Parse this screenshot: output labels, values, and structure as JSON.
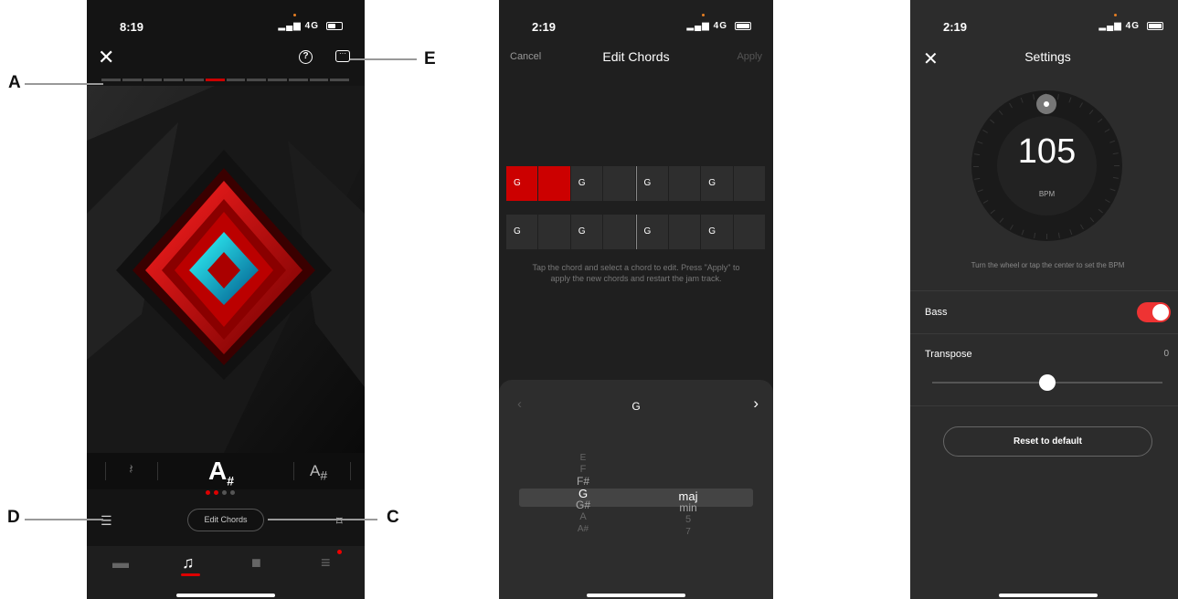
{
  "callouts": {
    "a": "A",
    "b": "E",
    "c": "C",
    "d": "D"
  },
  "phone1": {
    "time": "8:19",
    "signal": "4G",
    "current_chord_root": "A",
    "current_chord_accidental": "#",
    "next_chord_root": "A",
    "next_chord_accidental": "#",
    "edit_chords_label": "Edit Chords",
    "progress_segments": 12,
    "progress_active_index": 5,
    "accent_color": "#cc0000"
  },
  "phone2": {
    "time": "2:19",
    "signal": "4G",
    "cancel_label": "Cancel",
    "title": "Edit Chords",
    "apply_label": "Apply",
    "row1": [
      "G",
      "",
      "G",
      "",
      "G",
      "",
      "G",
      ""
    ],
    "row2": [
      "G",
      "",
      "G",
      "",
      "G",
      "",
      "G",
      ""
    ],
    "hint": "Tap the chord and select a chord to edit. Press \"Apply\" to apply the new chords and restart the jam track.",
    "selected_chord": "G",
    "roots": [
      "E",
      "F",
      "F#",
      "G",
      "G#",
      "A",
      "A#"
    ],
    "qualities": [
      "maj",
      "min",
      "5",
      "7"
    ]
  },
  "phone3": {
    "time": "2:19",
    "signal": "4G",
    "title": "Settings",
    "bpm": "105",
    "bpm_unit": "BPM",
    "hint": "Turn the wheel or tap the center to set the BPM",
    "bass_label": "Bass",
    "bass_on": true,
    "transpose_label": "Transpose",
    "transpose_value": "0",
    "reset_label": "Reset to default"
  }
}
